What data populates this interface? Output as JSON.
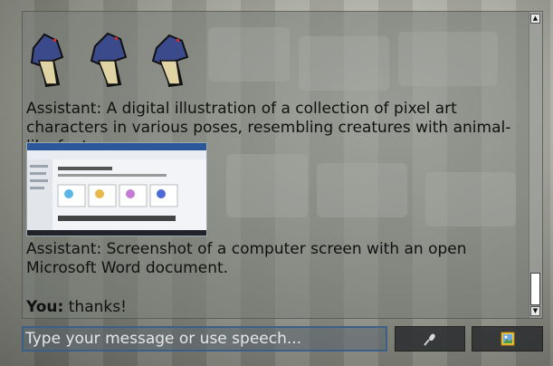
{
  "chat": {
    "messages": [
      {
        "text": "Assistant: A digital illustration of a collection of pixel art characters in various poses, resembling creatures with animal-like features."
      },
      {
        "text": "Assistant: Screenshot of a computer screen with an open Microsoft Word document."
      }
    ],
    "user_message": {
      "speaker": "You:",
      "text": "thanks!"
    }
  },
  "input": {
    "placeholder": "Type your message or use speech..."
  },
  "buttons": {
    "mic_icon": "microphone-icon",
    "image_icon": "image-icon"
  },
  "colors": {
    "input_border": "#3b5f86",
    "button_bg": "#2d3032"
  }
}
